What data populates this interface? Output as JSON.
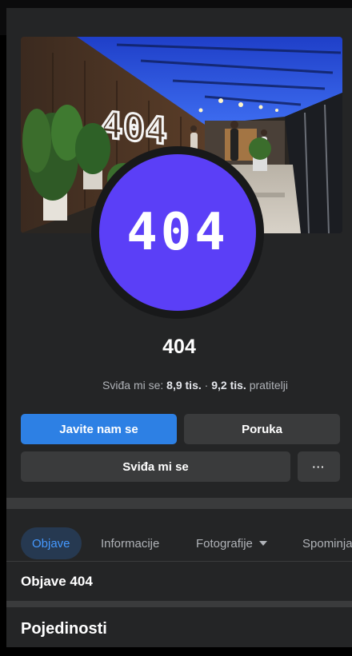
{
  "cover": {
    "neon_sign": "404"
  },
  "avatar": {
    "text": "404",
    "color": "#5b3ff7"
  },
  "page": {
    "name": "404"
  },
  "stats": {
    "likes_label": "Sviđa mi se:",
    "likes_value": "8,9 tis.",
    "separator": "·",
    "followers_value": "9,2 tis.",
    "followers_label": "pratitelji"
  },
  "actions": {
    "contact_label": "Javite nam se",
    "message_label": "Poruka",
    "like_label": "Sviđa mi se",
    "more_label": "···"
  },
  "tabs": [
    {
      "label": "Objave",
      "active": true
    },
    {
      "label": "Informacije",
      "active": false
    },
    {
      "label": "Fotografije",
      "active": false,
      "dropdown": true
    },
    {
      "label": "Spominjanja",
      "active": false
    }
  ],
  "sections": {
    "posts_title": "Objave 404",
    "details_title": "Pojedinosti"
  },
  "colors": {
    "primary": "#2d80e4",
    "background": "#242526",
    "surface": "#3a3b3c"
  }
}
